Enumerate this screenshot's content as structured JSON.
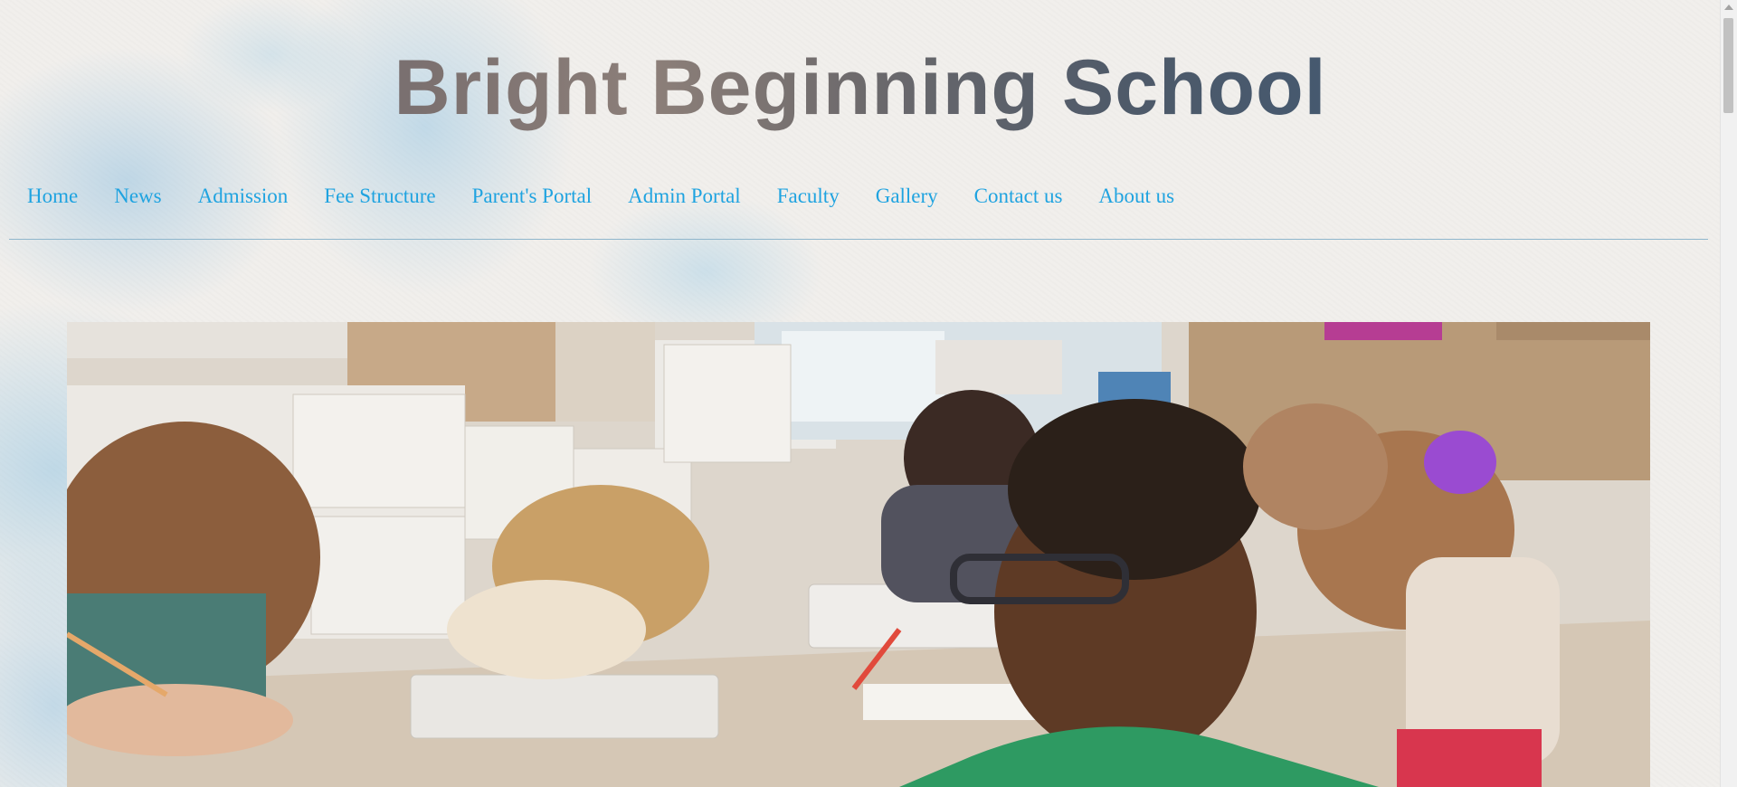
{
  "site": {
    "title": "Bright Beginning School"
  },
  "nav": {
    "items": [
      {
        "label": "Home"
      },
      {
        "label": "News"
      },
      {
        "label": "Admission"
      },
      {
        "label": "Fee Structure"
      },
      {
        "label": "Parent's Portal"
      },
      {
        "label": "Admin Portal"
      },
      {
        "label": "Faculty"
      },
      {
        "label": "Gallery"
      },
      {
        "label": "Contact us"
      },
      {
        "label": "About us"
      }
    ]
  },
  "colors": {
    "nav_link": "#1fa3e0",
    "title_gradient_start": "#5a6370",
    "title_gradient_end": "#405b78",
    "background": "#f1efec"
  },
  "hero": {
    "description": ""
  }
}
